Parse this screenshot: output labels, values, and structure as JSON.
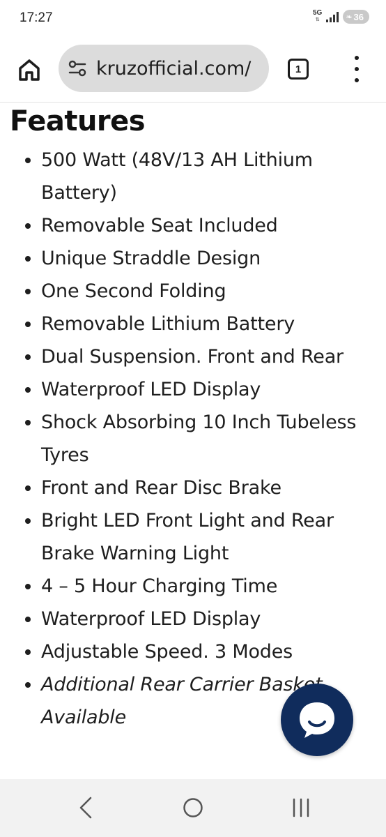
{
  "status_bar": {
    "time": "17:27",
    "network": "5G",
    "battery": "36"
  },
  "browser": {
    "url": "kruzofficial.com/",
    "tab_count": "1"
  },
  "content": {
    "heading": "Features",
    "features": [
      "500 Watt (48V/13 AH Lithium Battery)",
      "Removable Seat Included",
      "Unique Straddle Design",
      "One Second Folding",
      "Removable Lithium Battery",
      "Dual Suspension. Front and Rear",
      "Waterproof LED Display",
      "Shock Absorbing 10 Inch Tubeless Tyres",
      "Front and Rear Disc Brake",
      "Bright LED Front Light and Rear Brake Warning Light",
      "4 – 5 Hour Charging Time",
      "Waterproof LED Display",
      "Adjustable Speed. 3 Modes",
      "Additional Rear Carrier Basket Available"
    ]
  },
  "colors": {
    "chat_button": "#102c5c",
    "url_bar": "#dcdcdc",
    "nav_bar": "#f2f2f2"
  },
  "icons": {
    "home": "home-icon",
    "site_settings": "tune-icon",
    "menu": "more-vert-icon",
    "chat": "chat-bubble-icon",
    "back": "back-chevron-icon",
    "nav_home": "circle-home-icon",
    "recents": "recents-icon"
  }
}
